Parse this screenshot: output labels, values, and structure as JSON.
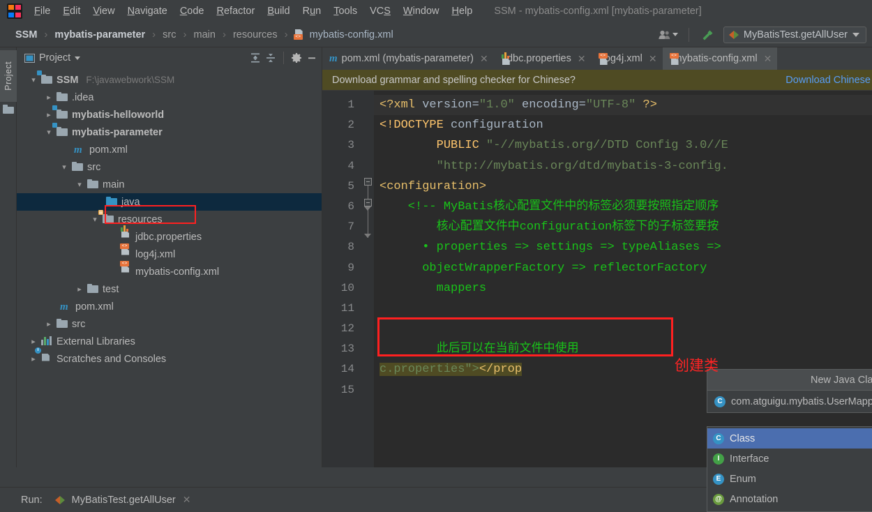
{
  "app": {
    "window_title": "SSM - mybatis-config.xml [mybatis-parameter]",
    "logo_name": "intellij-idea-logo"
  },
  "menubar": {
    "items": [
      {
        "label": "File",
        "mnemonic": "F"
      },
      {
        "label": "Edit",
        "mnemonic": "E"
      },
      {
        "label": "View",
        "mnemonic": "V"
      },
      {
        "label": "Navigate",
        "mnemonic": "N"
      },
      {
        "label": "Code",
        "mnemonic": "C"
      },
      {
        "label": "Refactor",
        "mnemonic": "R"
      },
      {
        "label": "Build",
        "mnemonic": "B"
      },
      {
        "label": "Run",
        "mnemonic": "u"
      },
      {
        "label": "Tools",
        "mnemonic": "T"
      },
      {
        "label": "VCS",
        "mnemonic": "S"
      },
      {
        "label": "Window",
        "mnemonic": "W"
      },
      {
        "label": "Help",
        "mnemonic": "H"
      }
    ]
  },
  "navbar": {
    "breadcrumbs": [
      {
        "label": "SSM",
        "style": "bold"
      },
      {
        "label": "mybatis-parameter",
        "style": "bold"
      },
      {
        "label": "src",
        "style": "dim"
      },
      {
        "label": "main",
        "style": "dim"
      },
      {
        "label": "resources",
        "style": "dim"
      },
      {
        "label": "mybatis-config.xml",
        "style": "file",
        "icon": "xml-file-icon"
      }
    ],
    "separator": "›",
    "people_icon": "people-icon",
    "build_icon": "hammer-icon",
    "run_config": {
      "label": "MyBatisTest.getAllUser",
      "icon": "run-config-icon"
    }
  },
  "left_strip": {
    "project_tab_label": "Project",
    "folder_icon": "folder-icon"
  },
  "project_panel": {
    "title": "Project",
    "title_icon": "project-view-icon",
    "toolbar": [
      {
        "name": "expand-all-icon"
      },
      {
        "name": "collapse-all-icon"
      },
      {
        "name": "gear-icon"
      },
      {
        "name": "minimize-icon"
      }
    ],
    "tree": [
      {
        "label": "SSM",
        "extra": "F:\\javawebwork\\SSM",
        "icon": "module-folder-icon",
        "arrow": "down",
        "indent": 0,
        "bold": true
      },
      {
        "label": ".idea",
        "icon": "folder-icon",
        "arrow": "right",
        "indent": 1,
        "bold": false
      },
      {
        "label": "mybatis-helloworld",
        "icon": "module-folder-icon",
        "arrow": "right",
        "indent": 1,
        "bold": true
      },
      {
        "label": "mybatis-parameter",
        "icon": "module-folder-icon",
        "arrow": "down",
        "indent": 1,
        "bold": true
      },
      {
        "label": "pom.xml",
        "icon": "maven-pom-icon",
        "arrow": "none",
        "indent": 2,
        "bold": false
      },
      {
        "label": "src",
        "icon": "folder-icon",
        "arrow": "down",
        "indent": 2,
        "bold": false
      },
      {
        "label": "main",
        "icon": "folder-icon",
        "arrow": "down",
        "indent": 3,
        "bold": false
      },
      {
        "label": "java",
        "icon": "source-folder-icon",
        "arrow": "none",
        "indent": 4,
        "bold": false,
        "selected": true,
        "highlighted": true
      },
      {
        "label": "resources",
        "icon": "resources-folder-icon",
        "arrow": "down",
        "indent": 4,
        "bold": false
      },
      {
        "label": "jdbc.properties",
        "icon": "properties-file-icon",
        "arrow": "none",
        "indent": 5,
        "bold": false
      },
      {
        "label": "log4j.xml",
        "icon": "xml-file-icon",
        "arrow": "none",
        "indent": 5,
        "bold": false
      },
      {
        "label": "mybatis-config.xml",
        "icon": "xml-file-icon",
        "arrow": "none",
        "indent": 5,
        "bold": false
      },
      {
        "label": "test",
        "icon": "folder-icon",
        "arrow": "right",
        "indent": 3,
        "bold": false
      },
      {
        "label": "pom.xml",
        "icon": "maven-pom-icon",
        "arrow": "none",
        "indent": 2,
        "bold": false
      },
      {
        "label": "src",
        "icon": "folder-icon",
        "arrow": "right",
        "indent": 2,
        "bold": false
      },
      {
        "label": "External Libraries",
        "icon": "external-libraries-icon",
        "arrow": "right",
        "indent": 0,
        "bold": false
      },
      {
        "label": "Scratches and Consoles",
        "icon": "scratches-icon",
        "arrow": "right",
        "indent": 0,
        "bold": false
      }
    ]
  },
  "editor": {
    "tabs": [
      {
        "label": "pom.xml (mybatis-parameter)",
        "icon": "maven-pom-icon",
        "active": false
      },
      {
        "label": "jdbc.properties",
        "icon": "properties-file-icon",
        "active": false
      },
      {
        "label": "log4j.xml",
        "icon": "xml-file-icon",
        "active": false
      },
      {
        "label": "mybatis-config.xml",
        "icon": "xml-file-icon",
        "active": true
      }
    ],
    "close_glyph": "✕",
    "notification": {
      "message": "Download grammar and spelling checker for Chinese?",
      "action": "Download Chinese"
    },
    "line_numbers": [
      "1",
      "2",
      "3",
      "4",
      "5",
      "6",
      "7",
      "8",
      "9",
      "10",
      "11",
      "12",
      "13",
      "14",
      "15"
    ],
    "lines": [
      {
        "n": 1,
        "segments": [
          {
            "t": "<?xml ",
            "c": "orange"
          },
          {
            "t": "version=",
            "c": "grey"
          },
          {
            "t": "\"1.0\"",
            "c": "green"
          },
          {
            "t": " encoding=",
            "c": "grey"
          },
          {
            "t": "\"UTF-8\"",
            "c": "green"
          },
          {
            "t": " ?>",
            "c": "orange"
          }
        ]
      },
      {
        "n": 2,
        "segments": [
          {
            "t": "<!DOCTYPE",
            "c": "yellow"
          },
          {
            "t": " configuration",
            "c": "grey"
          }
        ]
      },
      {
        "n": 3,
        "segments": [
          {
            "t": "        PUBLIC ",
            "c": "yellow"
          },
          {
            "t": "\"-//mybatis.org//DTD Config 3.0//E",
            "c": "green"
          }
        ]
      },
      {
        "n": 4,
        "segments": [
          {
            "t": "        \"http://mybatis.org/dtd/mybatis-3-config.",
            "c": "green"
          }
        ]
      },
      {
        "n": 5,
        "segments": [
          {
            "t": "<configuration>",
            "c": "orange"
          }
        ]
      },
      {
        "n": 6,
        "segments": [
          {
            "t": "    <!-- MyBatis核心配置文件中的标签必须要按照指定顺序",
            "c": "cgreen"
          }
        ]
      },
      {
        "n": 7,
        "segments": [
          {
            "t": "        核心配置文件中configuration标签下的子标签要按",
            "c": "cgreen"
          }
        ]
      },
      {
        "n": 8,
        "segments": [
          {
            "t": "      • properties => settings => typeAliases =>",
            "c": "cgreen"
          }
        ]
      },
      {
        "n": 9,
        "segments": [
          {
            "t": "      objectWrapperFactory => reflectorFactory",
            "c": "cgreen"
          }
        ]
      },
      {
        "n": 10,
        "segments": [
          {
            "t": "        mappers",
            "c": "cgreen"
          }
        ]
      },
      {
        "n": 11,
        "segments": [
          {
            "t": "",
            "c": "cgreen"
          }
        ]
      },
      {
        "n": 12,
        "segments": [
          {
            "t": "",
            "c": "cgreen"
          }
        ]
      },
      {
        "n": 13,
        "segments": [
          {
            "t": "        此后可以在当前文件中使用",
            "c": "cgreen"
          }
        ]
      },
      {
        "n": 14,
        "segments": [
          {
            "t": "c.properties\"></prop",
            "c": "green"
          }
        ]
      },
      {
        "n": 15,
        "segments": [
          {
            "t": "",
            "c": "grey"
          }
        ]
      }
    ]
  },
  "popup_new_class": {
    "title": "New Java Class",
    "value": "com.atguigu.mybatis.UserMapper",
    "value_icon": "class-icon"
  },
  "popup_kind_list": {
    "items": [
      {
        "label": "Class",
        "icon": "class-icon",
        "badge": "C",
        "selected": true
      },
      {
        "label": "Interface",
        "icon": "interface-icon",
        "badge": "I",
        "selected": false
      },
      {
        "label": "Enum",
        "icon": "enum-icon",
        "badge": "E",
        "selected": false
      },
      {
        "label": "Annotation",
        "icon": "annotation-icon",
        "badge": "@",
        "selected": false
      }
    ]
  },
  "annotations": {
    "create_class_text": "创建类"
  },
  "run_bar": {
    "label": "Run:",
    "config_name": "MyBatisTest.getAllUser",
    "icon": "run-config-icon",
    "close_glyph": "✕"
  },
  "colors": {
    "accent_blue": "#4b6eaf",
    "selection_navy": "#0d293e",
    "annotation_red": "#ff2020",
    "notification_olive": "#4f4b23",
    "editor_bg": "#2b2b2b",
    "panel_bg": "#3c3f41",
    "comment_green": "#19c319"
  }
}
